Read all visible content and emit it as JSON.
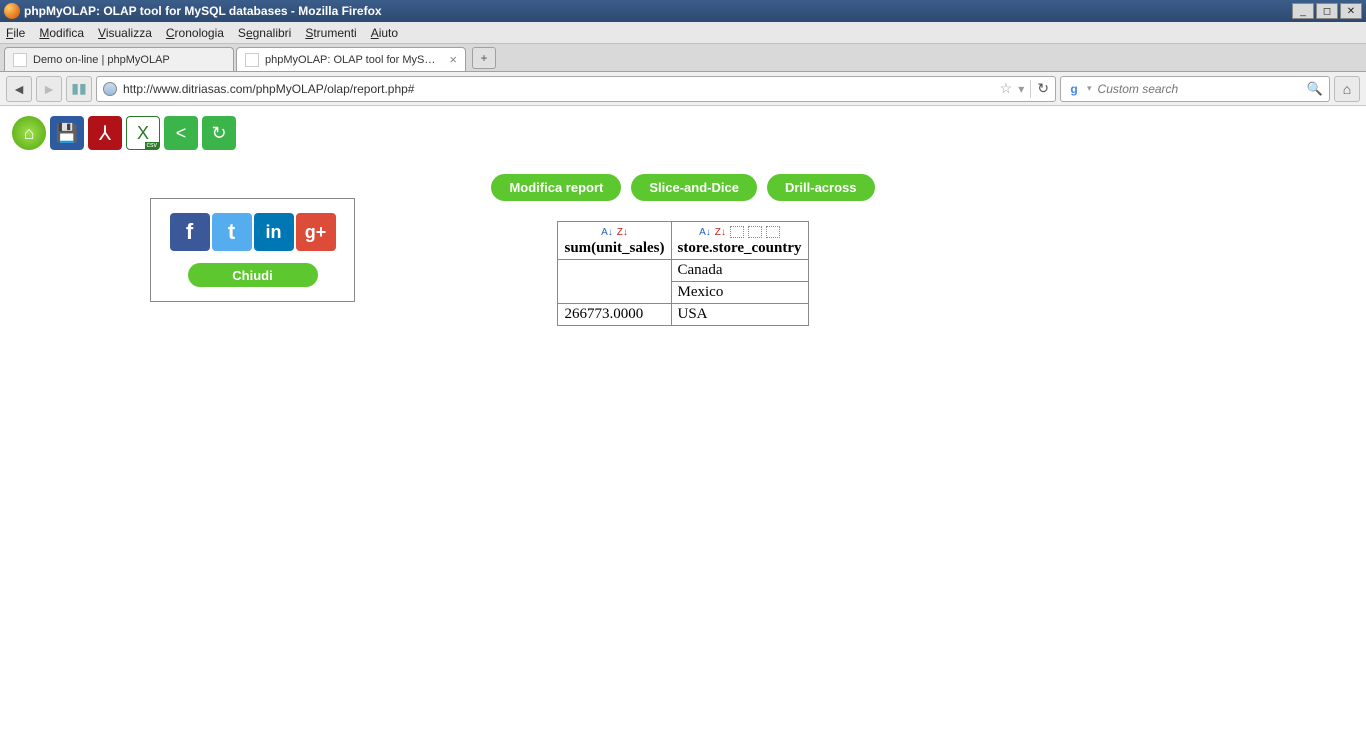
{
  "window": {
    "title": "phpMyOLAP: OLAP tool for MySQL databases - Mozilla Firefox"
  },
  "menu": {
    "file": "File",
    "edit": "Modifica",
    "view": "Visualizza",
    "history": "Cronologia",
    "bookmarks": "Segnalibri",
    "tools": "Strumenti",
    "help": "Aiuto"
  },
  "tabs": [
    {
      "label": "Demo on-line | phpMyOLAP",
      "active": false
    },
    {
      "label": "phpMyOLAP: OLAP tool for MySQL datab...",
      "active": true
    }
  ],
  "url": "http://www.ditriasas.com/phpMyOLAP/olap/report.php#",
  "search": {
    "placeholder": "Custom search"
  },
  "actions": {
    "modify": "Modifica report",
    "slice": "Slice-and-Dice",
    "drill": "Drill-across"
  },
  "share": {
    "close": "Chiudi"
  },
  "table": {
    "header_measure": "sum(unit_sales)",
    "header_dimension": "store.store_country",
    "rows": [
      {
        "value": "",
        "country": "Canada"
      },
      {
        "value": "",
        "country": "Mexico"
      },
      {
        "value": "266773.0000",
        "country": "USA"
      }
    ]
  }
}
